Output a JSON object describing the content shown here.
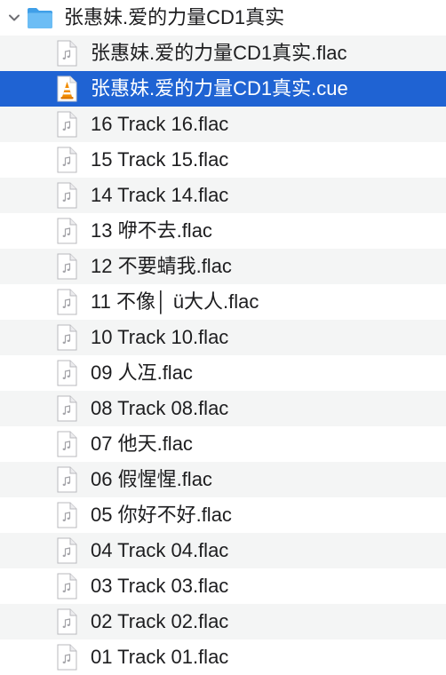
{
  "folder": {
    "name": "张惠妹.爱的力量CD1真实",
    "icon": "folder-icon",
    "expanded": true
  },
  "files": [
    {
      "name": "张惠妹.爱的力量CD1真实.flac",
      "icon": "audio-file-icon",
      "selected": false
    },
    {
      "name": "张惠妹.爱的力量CD1真实.cue",
      "icon": "vlc-cone-icon",
      "selected": true
    },
    {
      "name": "16 Track 16.flac",
      "icon": "audio-file-icon",
      "selected": false
    },
    {
      "name": "15 Track 15.flac",
      "icon": "audio-file-icon",
      "selected": false
    },
    {
      "name": "14 Track 14.flac",
      "icon": "audio-file-icon",
      "selected": false
    },
    {
      "name": "13 咿不去.flac",
      "icon": "audio-file-icon",
      "selected": false
    },
    {
      "name": "12 不要蜻我.flac",
      "icon": "audio-file-icon",
      "selected": false
    },
    {
      "name": "11 不像│  ü大人.flac",
      "icon": "audio-file-icon",
      "selected": false
    },
    {
      "name": "10 Track 10.flac",
      "icon": "audio-file-icon",
      "selected": false
    },
    {
      "name": "09 人冱.flac",
      "icon": "audio-file-icon",
      "selected": false
    },
    {
      "name": "08 Track 08.flac",
      "icon": "audio-file-icon",
      "selected": false
    },
    {
      "name": "07 他天.flac",
      "icon": "audio-file-icon",
      "selected": false
    },
    {
      "name": "06 假惺惺.flac",
      "icon": "audio-file-icon",
      "selected": false
    },
    {
      "name": "05 你好不好.flac",
      "icon": "audio-file-icon",
      "selected": false
    },
    {
      "name": "04 Track 04.flac",
      "icon": "audio-file-icon",
      "selected": false
    },
    {
      "name": "03 Track 03.flac",
      "icon": "audio-file-icon",
      "selected": false
    },
    {
      "name": "02 Track 02.flac",
      "icon": "audio-file-icon",
      "selected": false
    },
    {
      "name": "01 Track 01.flac",
      "icon": "audio-file-icon",
      "selected": false
    }
  ],
  "colors": {
    "selection": "#1f63d3",
    "stripe": "#f4f5f5",
    "folder": "#4aa6ee",
    "text": "#1d1d1f"
  }
}
